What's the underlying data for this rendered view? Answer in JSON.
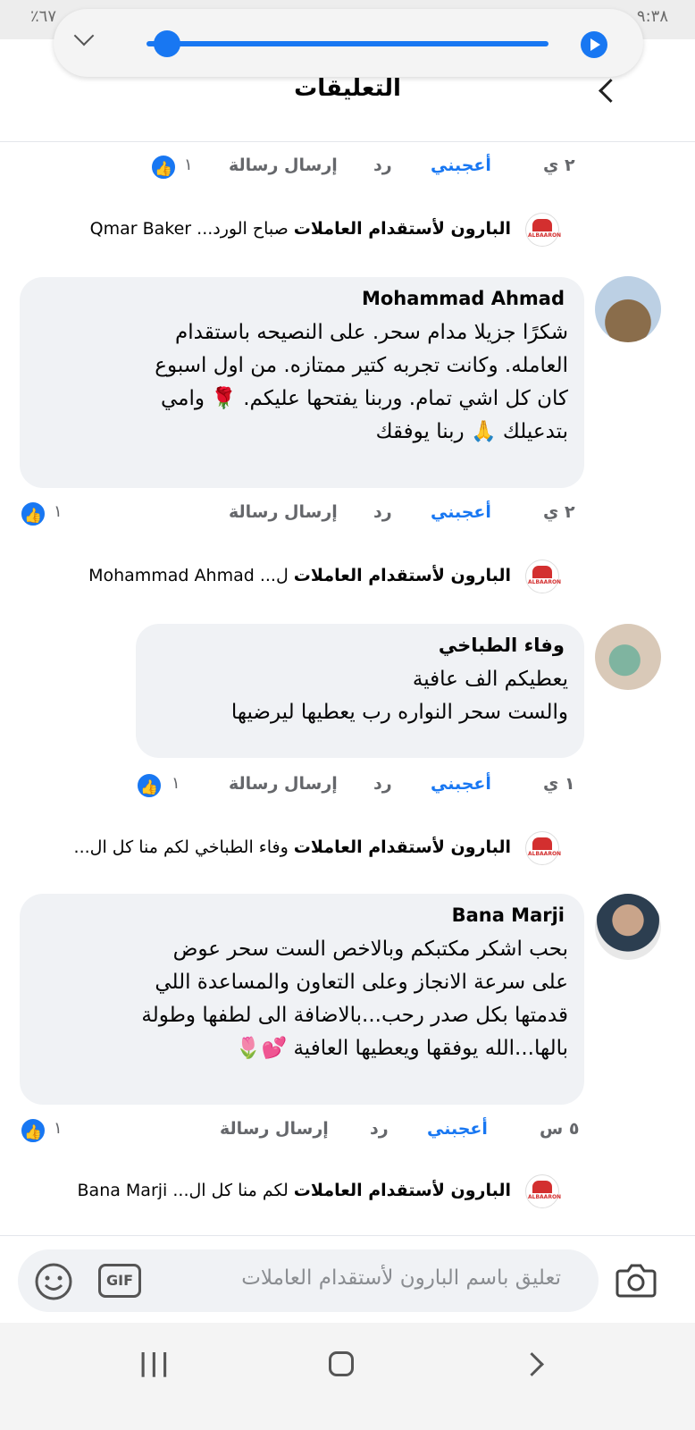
{
  "status_bar": {
    "left_text": "٪٦٧",
    "right_text": "٩:٣٨"
  },
  "header": {
    "title": "التعليقات"
  },
  "comments": [
    {
      "time": "٢ ي",
      "like_label": "أعجبني",
      "reply_label": "رد",
      "message_label": "إرسال رسالة",
      "like_count": "١"
    },
    {
      "author": "Mohammad Ahmad",
      "lines": [
        "شكرًا جزيلا مدام سحر. على النصيحه باستقدام",
        "العامله. وكانت تجربه كتير ممتازه. من اول اسبوع",
        "كان كل اشي تمام. وربنا يفتحها عليكم. 🌹 وامي",
        "بتدعيلك 🙏 ربنا يوفقك"
      ],
      "time": "٢ ي",
      "like_label": "أعجبني",
      "reply_label": "رد",
      "message_label": "إرسال رسالة",
      "like_count": "١"
    },
    {
      "author": "وفاء الطباخي",
      "lines": [
        "يعطيكم الف عافية",
        "والست سحر النواره رب يعطيها ليرضيها"
      ],
      "time": "١ ي",
      "like_label": "أعجبني",
      "reply_label": "رد",
      "message_label": "إرسال رسالة",
      "like_count": "١"
    },
    {
      "author": "Bana Marji",
      "lines": [
        "بحب اشكر مكتبكم وبالاخص الست سحر عوض",
        "على سرعة الانجاز وعلى التعاون والمساعدة اللي",
        "قدمتها بكل صدر رحب...بالاضافة الى لطفها وطولة",
        "بالها...الله يوفقها  ويعطيها العافية 💕🌷"
      ],
      "time": "٥ س",
      "like_label": "أعجبني",
      "reply_label": "رد",
      "message_label": "إرسال رسالة",
      "like_count": "١"
    }
  ],
  "replies": [
    {
      "page": "البارون لأستقدام العاملات",
      "snippet": "صباح الورد... Qmar Baker"
    },
    {
      "page": "البارون لأستقدام العاملات",
      "snippet": "ل... Mohammad Ahmad"
    },
    {
      "page": "البارون لأستقدام العاملات",
      "snippet": "وفاء الطباخي لكم منا كل ال..."
    },
    {
      "page": "البارون لأستقدام العاملات",
      "snippet": "لكم منا كل ال... Bana Marji"
    }
  ],
  "logo_text": "ALBAARON",
  "composer": {
    "placeholder": "تعليق باسم البارون لأستقدام العاملات",
    "gif_label": "GIF"
  },
  "nav": {
    "recents": "|||"
  },
  "colors": {
    "accent": "#1877f2",
    "bubble": "#f0f2f5",
    "muted": "#65676b"
  }
}
